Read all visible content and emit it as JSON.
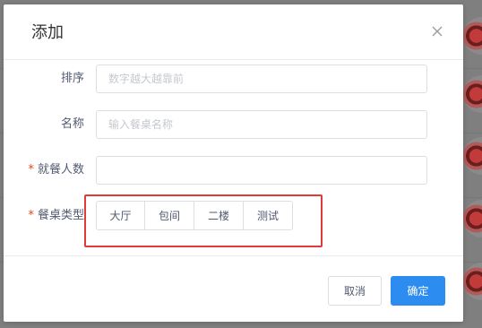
{
  "dialog": {
    "title": "添加"
  },
  "form": {
    "sort": {
      "label": "排序",
      "placeholder": "数字越大越靠前",
      "value": ""
    },
    "name": {
      "label": "名称",
      "placeholder": "输入餐桌名称",
      "value": ""
    },
    "seats": {
      "label": "就餐人数",
      "required": true,
      "placeholder": "",
      "value": ""
    },
    "table_type": {
      "label": "餐桌类型",
      "required": true,
      "options": [
        "大厅",
        "包间",
        "二楼",
        "测试"
      ]
    }
  },
  "footer": {
    "cancel_label": "取消",
    "ok_label": "确定"
  },
  "colors": {
    "primary": "#2d8cf0",
    "required": "#ed4014",
    "highlight": "#e03a3a"
  }
}
